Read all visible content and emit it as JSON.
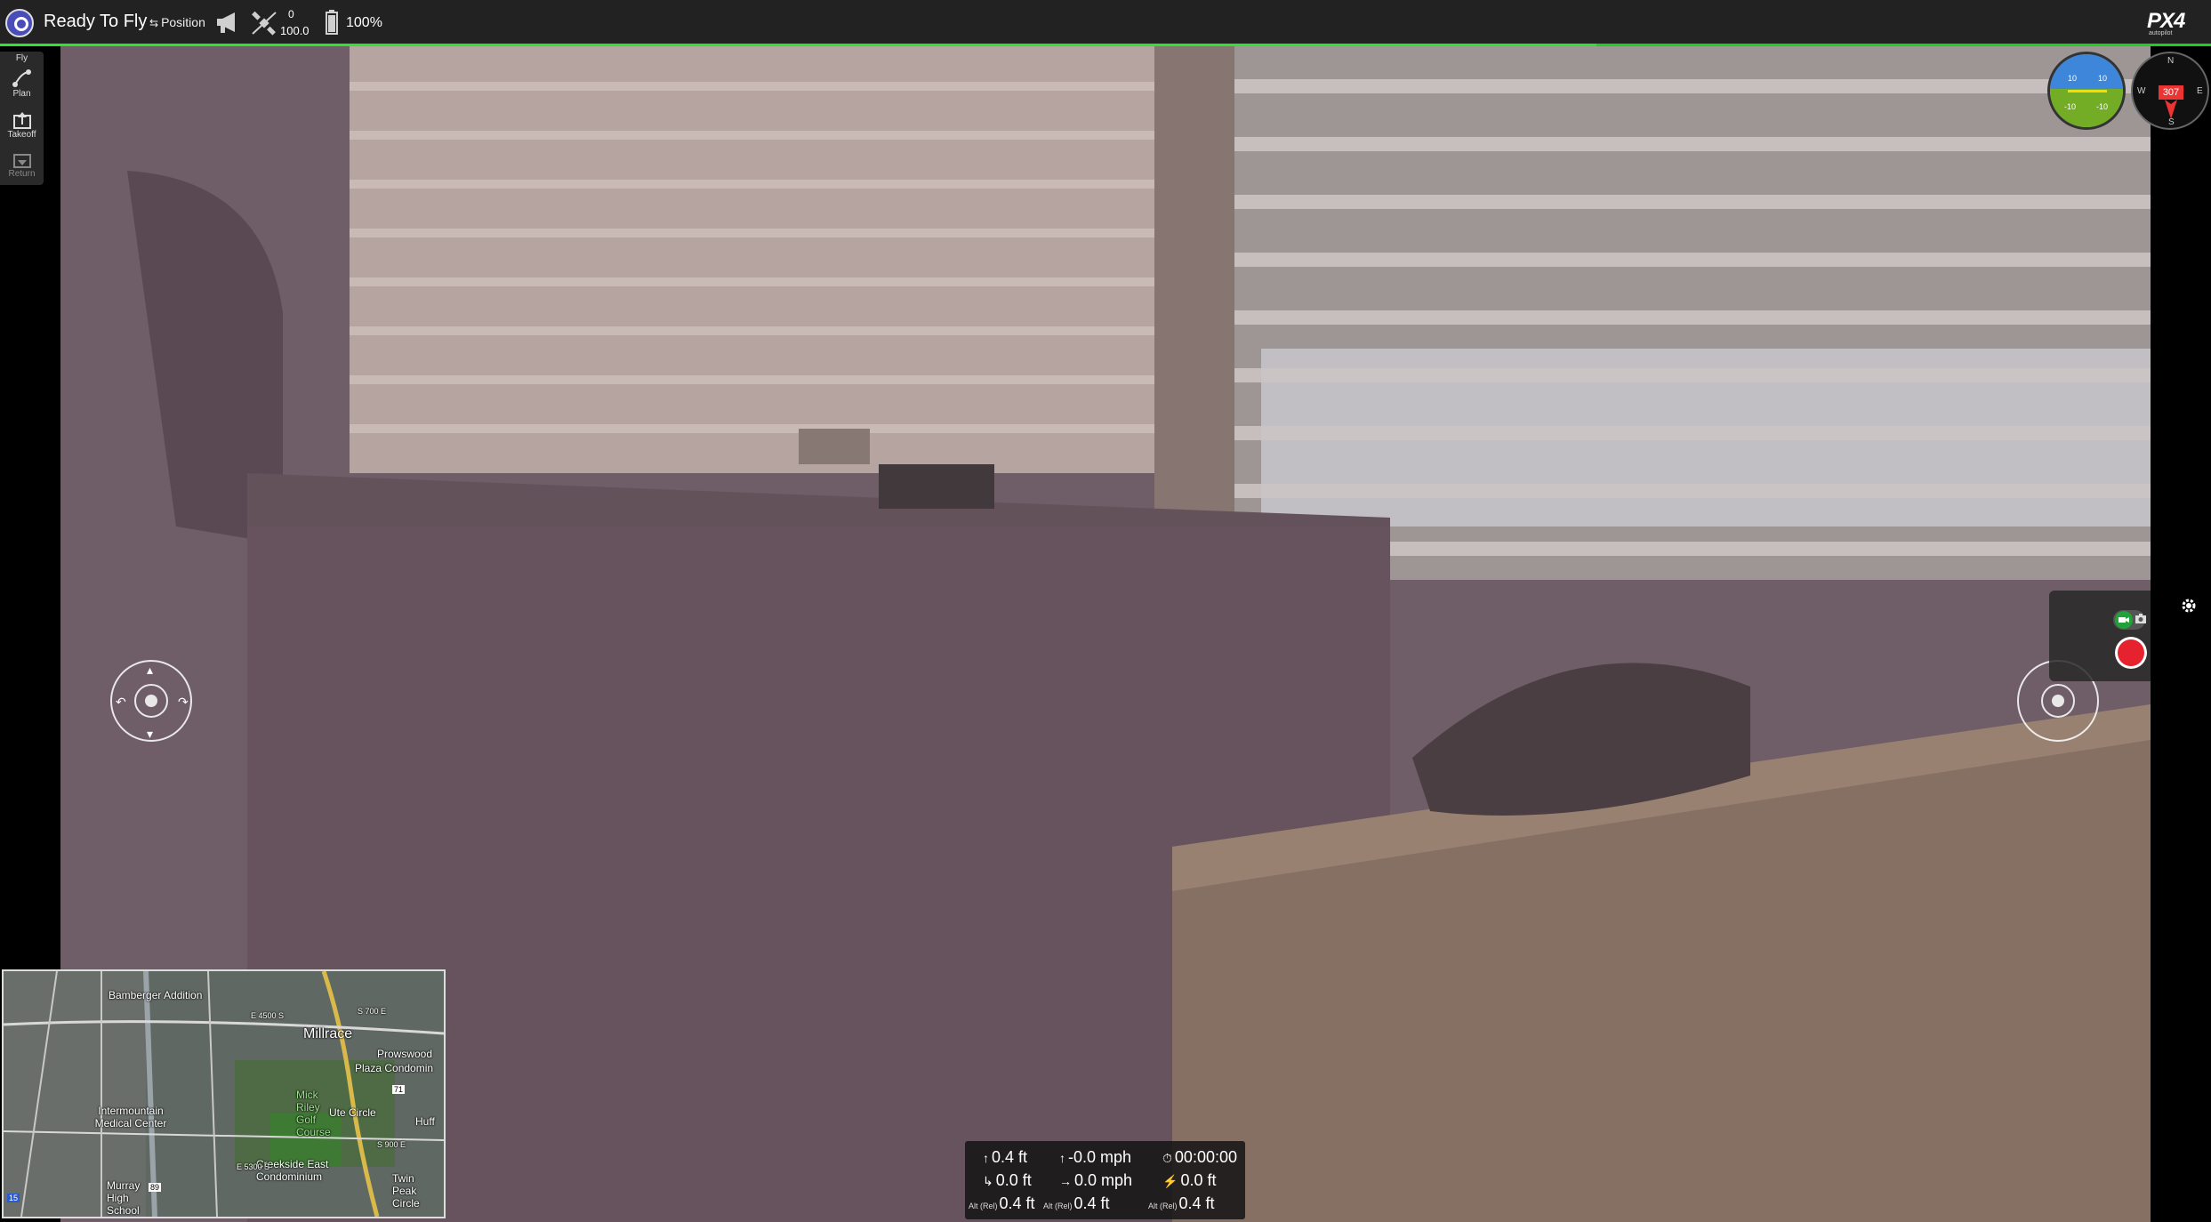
{
  "toolbar": {
    "status": "Ready To Fly",
    "flight_mode": "Position",
    "gps": {
      "count": "0",
      "hdop": "100.0"
    },
    "battery": "100%",
    "logo_text": "PX4",
    "logo_subtext": "autopilot",
    "accent_color": "#1bd11b"
  },
  "toolstrip": {
    "title": "Fly",
    "items": [
      {
        "label": "Plan",
        "icon": "plan-icon"
      },
      {
        "label": "Takeoff",
        "icon": "takeoff-icon"
      },
      {
        "label": "Return",
        "icon": "return-icon"
      }
    ]
  },
  "instruments": {
    "attitude": {
      "pitch_up": "10",
      "pitch_down": "-10"
    },
    "compass": {
      "heading": "307",
      "n": "N",
      "e": "E",
      "s": "S",
      "w": "W"
    }
  },
  "camera": {
    "mode": "video",
    "record_color": "#e5222d"
  },
  "minimap": {
    "labels": [
      "Bamberger Addition",
      "Millrace",
      "Prowswood",
      "Plaza Condomin",
      "Mick Riley Golf Course",
      "Intermountain Medical Center",
      "Ute Circle",
      "Creekside East Condominium",
      "Twin Peak Circle",
      "Murray High School",
      "Huff",
      "E 4500 S",
      "S 700 E",
      "E 5300 S",
      "S 900 E",
      "71",
      "89",
      "15"
    ]
  },
  "telemetry": {
    "altitude": "0.4 ft",
    "vertical_speed": "-0.0 mph",
    "flight_time": "00:00:00",
    "distance": "0.0 ft",
    "horizontal_speed": "0.0 mph",
    "distance_to_home": "0.0 ft",
    "alt_rel_1": "0.4 ft",
    "alt_rel_2": "0.4 ft",
    "alt_rel_3": "0.4 ft",
    "alt_rel_label": "Alt (Rel)"
  }
}
